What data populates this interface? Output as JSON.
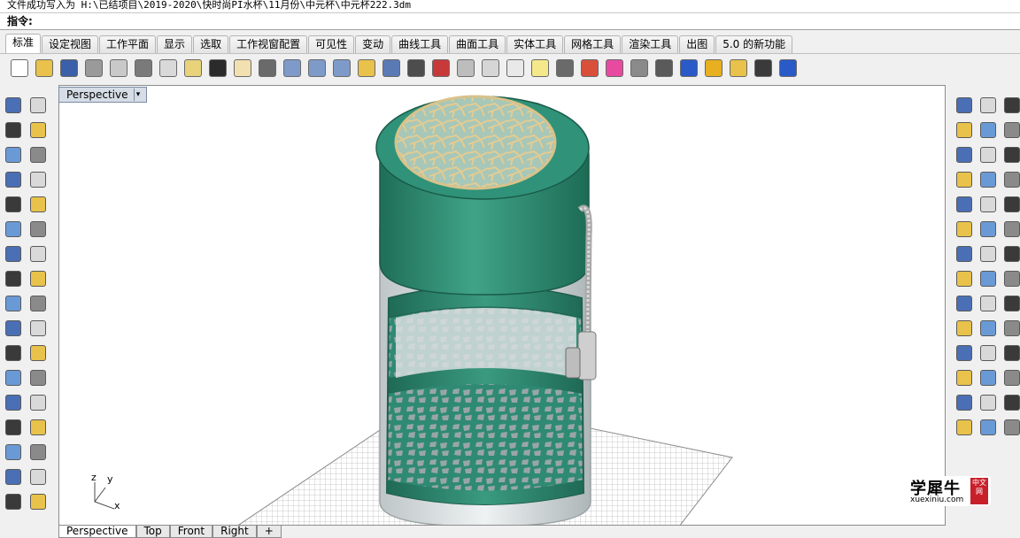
{
  "window": {
    "status_text": "文件成功写入为 H:\\已结项目\\2019-2020\\快时尚PI水杯\\11月份\\中元杯\\中元杯222.3dm",
    "command_prompt": "指令:"
  },
  "tabs": [
    {
      "label": "标准",
      "active": true
    },
    {
      "label": "设定视图"
    },
    {
      "label": "工作平面"
    },
    {
      "label": "显示"
    },
    {
      "label": "选取"
    },
    {
      "label": "工作视窗配置"
    },
    {
      "label": "可见性"
    },
    {
      "label": "变动"
    },
    {
      "label": "曲线工具"
    },
    {
      "label": "曲面工具"
    },
    {
      "label": "实体工具"
    },
    {
      "label": "网格工具"
    },
    {
      "label": "渲染工具"
    },
    {
      "label": "出图"
    },
    {
      "label": "5.0 的新功能"
    }
  ],
  "toolbar": [
    {
      "icon": "new-file-icon",
      "color": "#ffffff"
    },
    {
      "icon": "open-folder-icon",
      "color": "#e8c24a"
    },
    {
      "icon": "save-icon",
      "color": "#3b5fa8"
    },
    {
      "icon": "print-icon",
      "color": "#9a9a9a"
    },
    {
      "icon": "clipboard-icon",
      "color": "#c9c9c9"
    },
    {
      "icon": "cut-icon",
      "color": "#7a7a7a"
    },
    {
      "icon": "copy-icon",
      "color": "#d9d9d9"
    },
    {
      "icon": "paste-icon",
      "color": "#e8d27a"
    },
    {
      "icon": "undo-icon",
      "color": "#2b2b2b"
    },
    {
      "icon": "pan-hand-icon",
      "color": "#f2e0b0"
    },
    {
      "icon": "move-view-icon",
      "color": "#6a6a6a"
    },
    {
      "icon": "zoom-icon",
      "color": "#7d9ac9"
    },
    {
      "icon": "zoom-window-icon",
      "color": "#7d9ac9"
    },
    {
      "icon": "zoom-extents-icon",
      "color": "#7d9ac9"
    },
    {
      "icon": "zoom-selected-icon",
      "color": "#e8c24a"
    },
    {
      "icon": "rotate-view-icon",
      "color": "#5a7ab5"
    },
    {
      "icon": "four-viewports-icon",
      "color": "#4d4d4d"
    },
    {
      "icon": "car-icon",
      "color": "#c83a3a"
    },
    {
      "icon": "grid-options-icon",
      "color": "#bdbdbd"
    },
    {
      "icon": "osnap-icon",
      "color": "#d6d6d6"
    },
    {
      "icon": "point-icon",
      "color": "#e9e9e9"
    },
    {
      "icon": "light-bulb-icon",
      "color": "#f5e88a"
    },
    {
      "icon": "lock-icon",
      "color": "#6a6a6a"
    },
    {
      "icon": "layer-icon",
      "color": "#d8503a"
    },
    {
      "icon": "color-wheel-icon",
      "color": "#e84aa0"
    },
    {
      "icon": "shaded-sphere-icon",
      "color": "#8a8a8a"
    },
    {
      "icon": "rendered-sphere-icon",
      "color": "#5a5a5a"
    },
    {
      "icon": "render-sphere-icon",
      "color": "#2a5ac8"
    },
    {
      "icon": "material-cone-icon",
      "color": "#e8b020"
    },
    {
      "icon": "gear-settings-icon",
      "color": "#e8c24a"
    },
    {
      "icon": "dimension-icon",
      "color": "#3a3a3a"
    },
    {
      "icon": "help-icon",
      "color": "#2a5ac8"
    }
  ],
  "left_tools": [
    "select-arrow-icon",
    "point-icon",
    "polyline-icon",
    "curve-icon",
    "circle-icon",
    "ellipse-icon",
    "arc-icon",
    "rectangle-icon",
    "polygon-icon",
    "fillet-curve-icon",
    "surface-patch-icon",
    "sweep-icon",
    "box-icon",
    "sphere-icon",
    "extrude-icon",
    "mesh-surface-icon",
    "explode-icon",
    "boolean-icon",
    "trim-icon",
    "split-icon",
    "group-icon",
    "ungroup-icon",
    "offset-icon",
    "chamfer-icon",
    "text-icon",
    "dimension-icon",
    "array-icon",
    "mirror-icon",
    "solid-box-icon",
    "unroll-icon",
    "grid-array-icon",
    "flow-icon",
    "block-icon",
    "check-icon",
    "layer-fill-icon",
    "paint-icon"
  ],
  "right_tools": [
    "gear-icon",
    "explode-flash-icon",
    "edge-icon",
    "scale-icon",
    "line-icon",
    "curve-arc-icon",
    "circle-point-icon",
    "rectangle-icon",
    "curve-icon",
    "offset-2-icon",
    "sweep-curve-icon",
    "fillet-icon",
    "revolve-icon",
    "loft-icon",
    "blend-icon",
    "network-icon",
    "patch-icon",
    "sphere-quad-icon",
    "extrude-surface-icon",
    "rail-icon",
    "skin-icon",
    "planar-icon",
    "twist-icon",
    "bend-icon",
    "stack-layers-icon",
    "solid-join-icon",
    "cap-icon",
    "cylinder-icon",
    "cone-icon",
    "tube-icon",
    "boolean-diff-icon",
    "boolean-union-icon",
    "boolean-split-icon",
    "torus-icon",
    "pyramid-icon",
    "cube-icon",
    "cube-solid-icon",
    "sphere-solid-icon",
    "flat-surface-icon",
    "box-edit-icon",
    "point-cloud-icon",
    "box-wire-icon"
  ],
  "viewport": {
    "label": "Perspective",
    "axis_x": "x",
    "axis_y": "y",
    "axis_z": "z"
  },
  "view_tabs": [
    {
      "label": "Perspective",
      "active": true
    },
    {
      "label": "Top"
    },
    {
      "label": "Front"
    },
    {
      "label": "Right"
    },
    {
      "label": "+"
    }
  ],
  "watermark": {
    "title": "学犀牛",
    "url": "xuexiniu.com",
    "seal": "中文网"
  },
  "colors": {
    "bottle_green": "#2f8a74",
    "lid_green": "#2c8a70",
    "gold_mesh": "#d8c28a",
    "glass": "#dfe6e8"
  }
}
